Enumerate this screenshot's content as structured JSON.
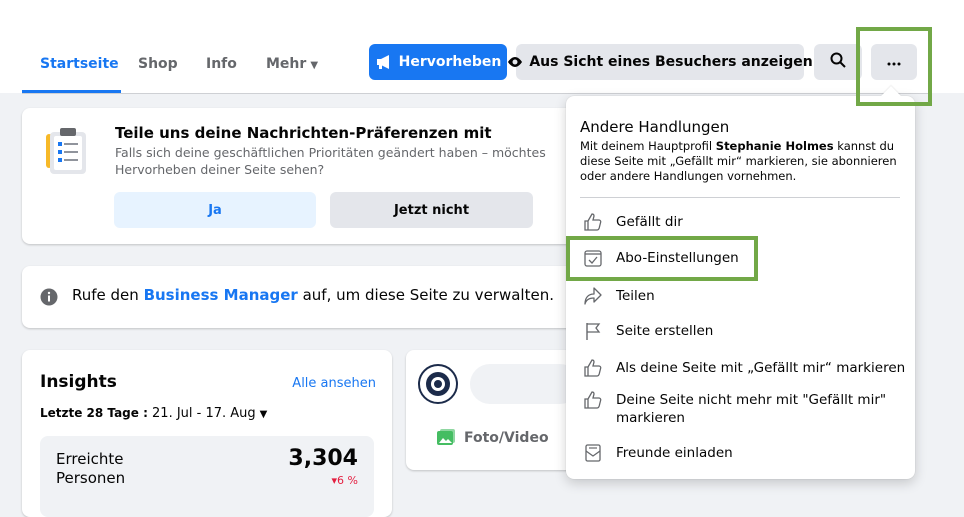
{
  "nav": {
    "tabs": [
      {
        "label": "Startseite",
        "active": true
      },
      {
        "label": "Shop"
      },
      {
        "label": "Info"
      },
      {
        "label": "Mehr"
      }
    ],
    "buttons": {
      "promote": "Hervorheben",
      "visitor_view": "Aus Sicht eines Besuchers anzeigen"
    },
    "icons": [
      "megaphone-icon",
      "eye-icon",
      "search-icon",
      "more-icon",
      "chevron-down-icon"
    ]
  },
  "preferences_card": {
    "title": "Teile uns deine Nachrichten-Präferenzen mit",
    "text_line1": "Falls sich deine geschäftlichen Prioritäten geändert haben – möchtes",
    "text_line2": "Hervorheben deiner Seite sehen?",
    "yes_label": "Ja",
    "no_label": "Jetzt nicht",
    "icon": "clipboard-checklist-icon"
  },
  "business_manager": {
    "prefix": "Rufe den ",
    "link": "Business Manager",
    "suffix": " auf, um diese Seite zu verwalten.",
    "icon": "info-icon"
  },
  "insights": {
    "title": "Insights",
    "see_all": "Alle ansehen",
    "range_label": "Letzte 28 Tage :",
    "range_value": " 21. Jul - 17. Aug",
    "metric_label": "Erreichte Personen",
    "metric_value": "3,304",
    "metric_change": "▾6 %"
  },
  "post_card": {
    "photo_video": "Foto/Video",
    "icons": [
      "page-avatar-icon",
      "photo-icon"
    ]
  },
  "dropdown": {
    "heading": "Andere Handlungen",
    "desc_prefix": "Mit deinem Hauptprofil ",
    "desc_name": "Stephanie Holmes",
    "desc_suffix": " kannst du diese Seite mit „Gefällt mir“ markieren, sie abonnieren oder andere Handlungen vornehmen.",
    "items": [
      {
        "label": "Gefällt dir",
        "icon": "thumbs-up-icon"
      },
      {
        "label": "Abo-Einstellungen",
        "icon": "subscribe-icon"
      },
      {
        "label": "Teilen",
        "icon": "share-icon"
      },
      {
        "label": "Seite erstellen",
        "icon": "flag-icon"
      },
      {
        "label": "Als deine Seite mit „Gefällt mir“ markieren",
        "icon": "thumbs-up-icon"
      },
      {
        "label": "Deine Seite nicht mehr mit \"Gefällt mir\" markieren",
        "icon": "thumbs-up-icon"
      },
      {
        "label": "Freunde einladen",
        "icon": "invite-icon"
      }
    ]
  },
  "colors": {
    "accent": "#1877f2",
    "highlight_box": "#72a847",
    "negative": "#e41e3f",
    "background": "#f0f2f5"
  }
}
